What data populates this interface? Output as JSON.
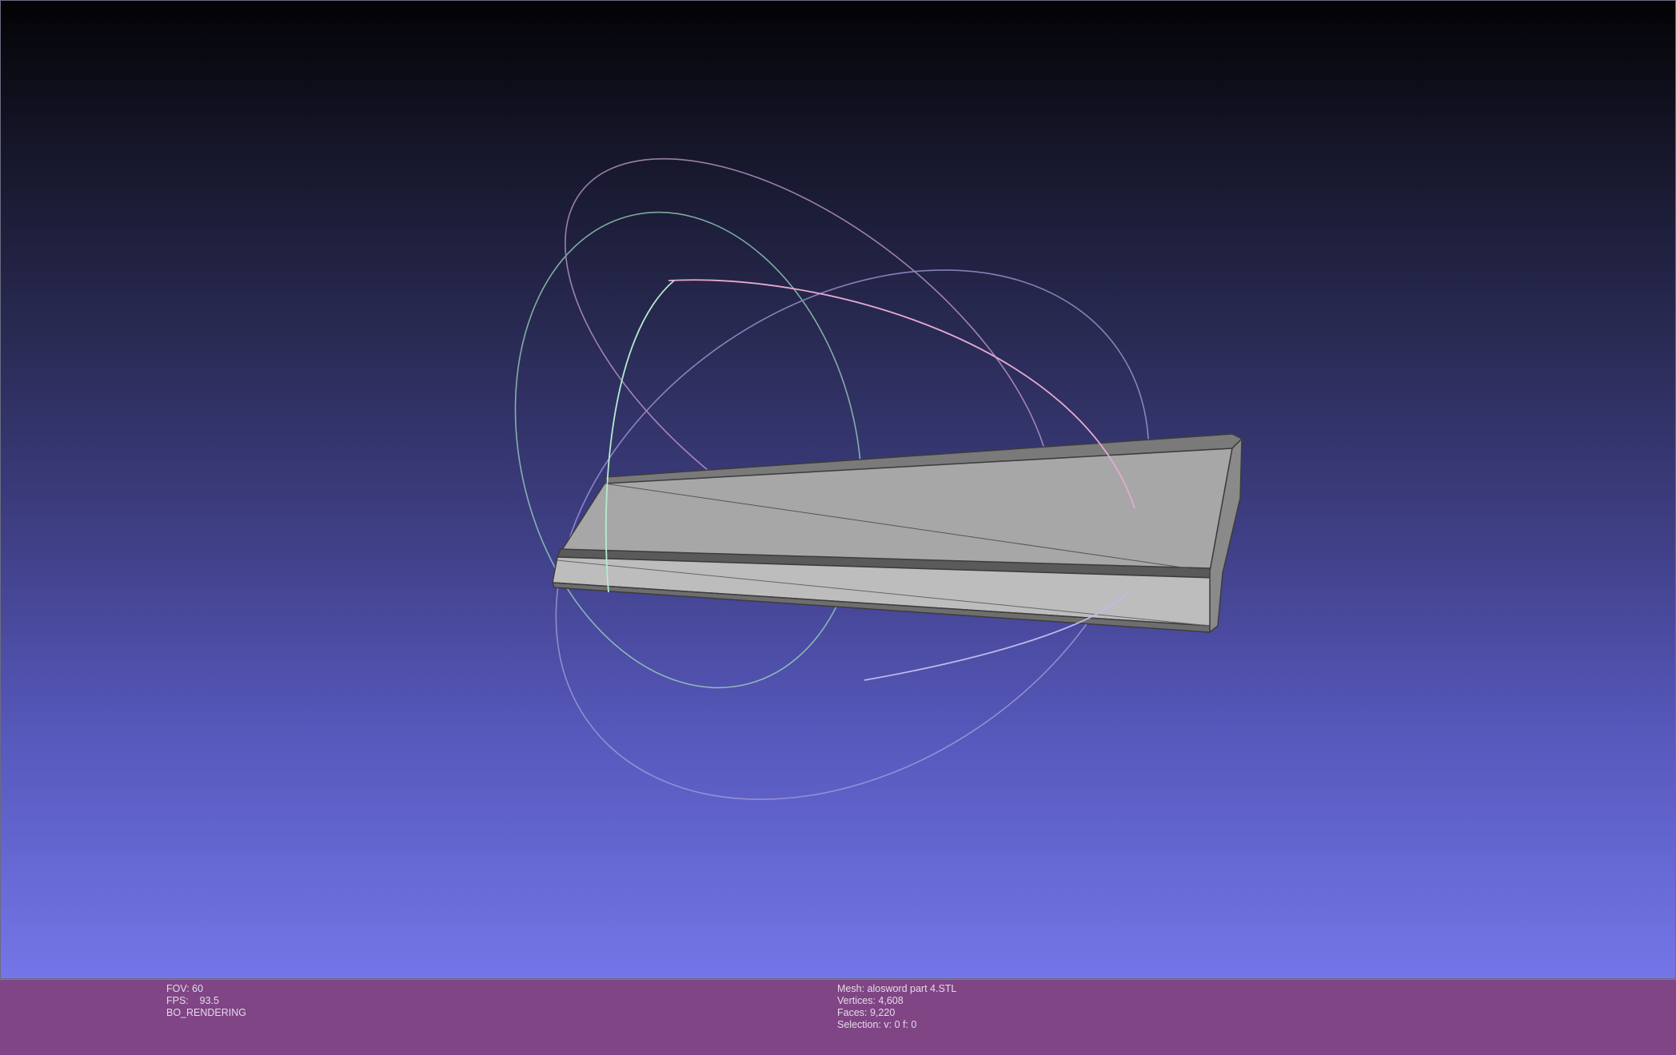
{
  "window": {
    "background_top": "#030305",
    "background_bottom": "#7476e8",
    "infobar_color": "#7f4585"
  },
  "info_left": {
    "fov": "FOV: 60",
    "fps": "FPS:    93.5",
    "mode": "BO_RENDERING"
  },
  "info_right": {
    "mesh": "Mesh: alosword part 4.STL",
    "vertices": "Vertices: 4,608",
    "faces": "Faces: 9,220",
    "selection": "Selection: v: 0 f: 0"
  },
  "scene": {
    "object": "mesh-part",
    "mesh_color": "#a9a9a9",
    "trackball_colors": {
      "x": "#e0a0c8",
      "y": "#a8e6c0",
      "z": "#b8b0e8"
    }
  }
}
